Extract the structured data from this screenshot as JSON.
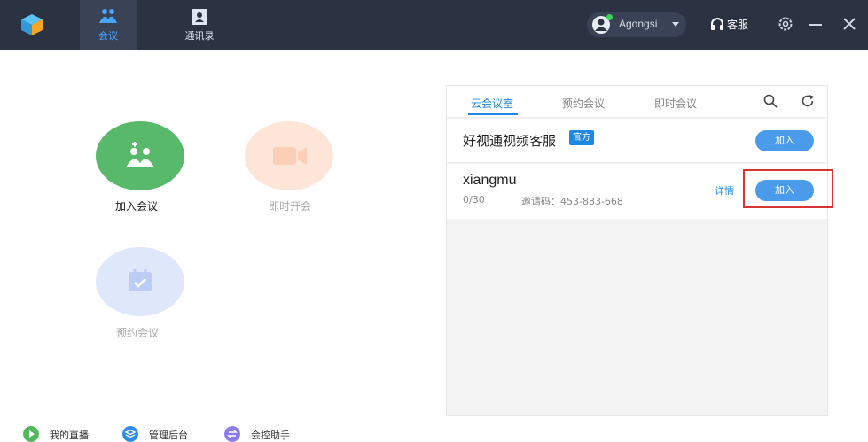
{
  "topbar": {
    "tabs": [
      {
        "label": "会议",
        "icon": "meeting-people-icon",
        "active": true
      },
      {
        "label": "通讯录",
        "icon": "contacts-icon",
        "active": false
      }
    ],
    "user": {
      "name": "Agongsi",
      "status_color": "#39d353"
    },
    "service_label": "客服",
    "icons": [
      "app-logo-icon",
      "headset-icon",
      "gear-icon",
      "minimize-icon",
      "close-icon"
    ]
  },
  "actions": [
    {
      "label": "加入会议",
      "color": "#58b96a"
    },
    {
      "label": "即时开会",
      "color": "#fde6d8"
    },
    {
      "label": "预约会议",
      "color": "#dfe7fb"
    }
  ],
  "bottom_links": [
    {
      "label": "我的直播",
      "color": "#52b75f"
    },
    {
      "label": "管理后台",
      "color": "#2e8bea"
    },
    {
      "label": "会控助手",
      "color": "#8b7cf0"
    }
  ],
  "panel": {
    "tabs": [
      {
        "label": "云会议室",
        "active": true
      },
      {
        "label": "预约会议",
        "active": false
      },
      {
        "label": "即时会议",
        "active": false
      }
    ],
    "rooms": [
      {
        "name": "好视通视频客服",
        "badge": "官方",
        "join_label": "加入"
      },
      {
        "name": "xiangmu",
        "count": "0/30",
        "invite": "邀请码：453-883-668",
        "details_label": "详情",
        "join_label": "加入"
      }
    ]
  },
  "colors": {
    "topbar": "#2b3342",
    "accent": "#1e88e5",
    "join_button": "#4a9bea",
    "highlight": "#d93434"
  }
}
